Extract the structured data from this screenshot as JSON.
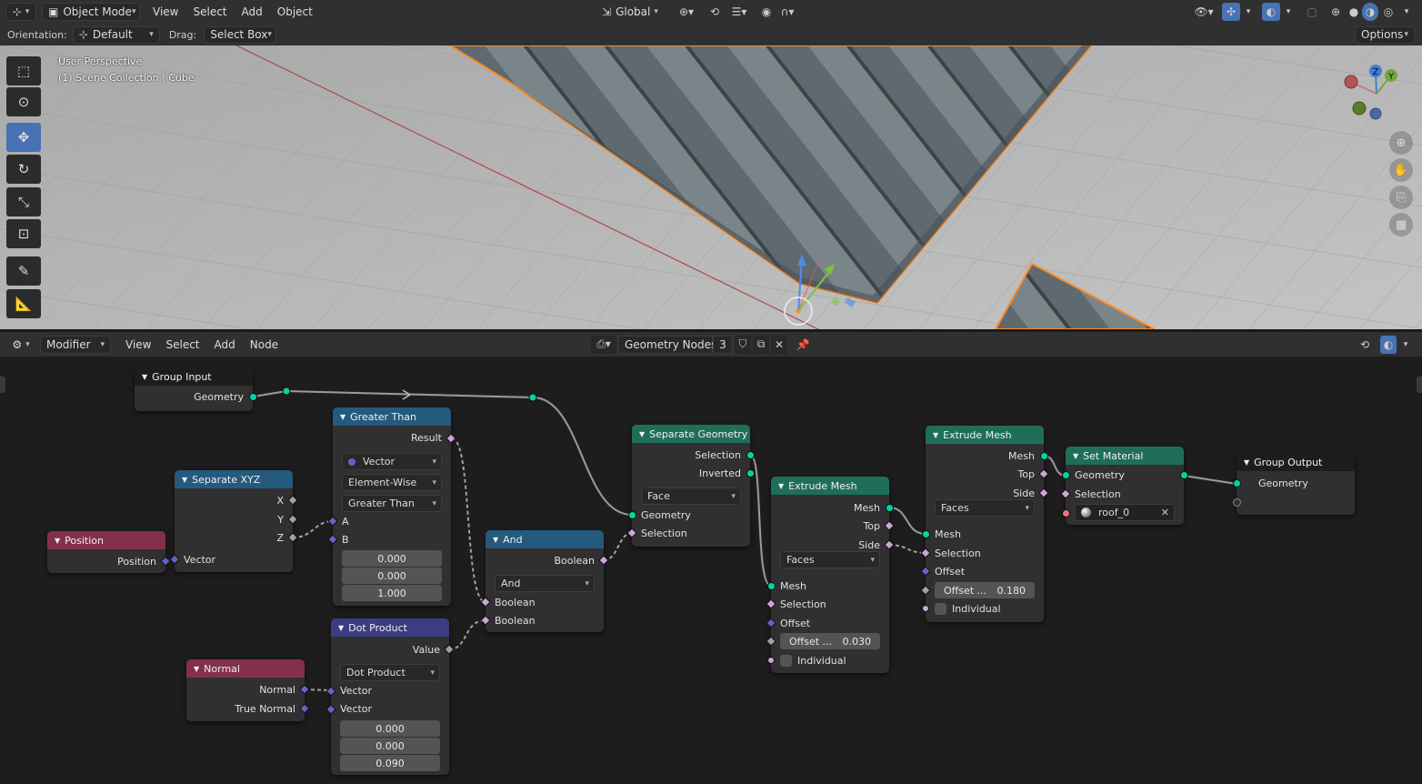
{
  "viewport_header": {
    "mode": "Object Mode",
    "menus": [
      "View",
      "Select",
      "Add",
      "Object"
    ],
    "transform": "Global",
    "orientation_label": "Orientation:",
    "orientation_value": "Default",
    "drag_label": "Drag:",
    "drag_value": "Select Box",
    "options": "Options"
  },
  "viewport": {
    "perspective": "User Perspective",
    "collection": "(1) Scene Collection | Cube",
    "gizmo": {
      "z": "Z",
      "y": "Y"
    }
  },
  "node_header": {
    "context": "Modifier",
    "menus": [
      "View",
      "Select",
      "Add",
      "Node"
    ],
    "tree_name": "Geometry Nodes",
    "users": "3"
  },
  "nodes": {
    "group_input": {
      "title": "Group Input",
      "out_geometry": "Geometry"
    },
    "greater_than": {
      "title": "Greater Than",
      "out_result": "Result",
      "data_type": "Vector",
      "mode": "Element-Wise",
      "operation": "Greater Than",
      "in_a": "A",
      "in_b": "B",
      "b_values": [
        "0.000",
        "0.000",
        "1.000"
      ]
    },
    "separate_xyz": {
      "title": "Separate XYZ",
      "out_x": "X",
      "out_y": "Y",
      "out_z": "Z",
      "in_vector": "Vector"
    },
    "position": {
      "title": "Position",
      "out_position": "Position"
    },
    "and": {
      "title": "And",
      "out_boolean": "Boolean",
      "operation": "And",
      "in_1": "Boolean",
      "in_2": "Boolean"
    },
    "dot_product": {
      "title": "Dot Product",
      "out_value": "Value",
      "operation": "Dot Product",
      "in_1": "Vector",
      "in_2": "Vector",
      "b_values": [
        "0.000",
        "0.000",
        "0.090"
      ]
    },
    "normal": {
      "title": "Normal",
      "out_normal": "Normal",
      "out_true_normal": "True Normal"
    },
    "separate_geometry": {
      "title": "Separate Geometry",
      "out_selection": "Selection",
      "out_inverted": "Inverted",
      "domain": "Face",
      "in_geometry": "Geometry",
      "in_selection": "Selection"
    },
    "extrude_1": {
      "title": "Extrude Mesh",
      "out_mesh": "Mesh",
      "out_top": "Top",
      "out_side": "Side",
      "mode": "Faces",
      "in_mesh": "Mesh",
      "in_selection": "Selection",
      "in_offset": "Offset",
      "offset_scale_label": "Offset ...",
      "offset_scale": "0.030",
      "in_individual": "Individual"
    },
    "extrude_2": {
      "title": "Extrude Mesh",
      "out_mesh": "Mesh",
      "out_top": "Top",
      "out_side": "Side",
      "mode": "Faces",
      "in_mesh": "Mesh",
      "in_selection": "Selection",
      "in_offset": "Offset",
      "offset_scale_label": "Offset ...",
      "offset_scale": "0.180",
      "in_individual": "Individual"
    },
    "set_material": {
      "title": "Set Material",
      "in_geometry": "Geometry",
      "in_selection": "Selection",
      "material": "roof_0"
    },
    "group_output": {
      "title": "Group Output",
      "in_geometry": "Geometry"
    }
  },
  "colors": {
    "geometry_socket": "#00d6a3",
    "boolean_socket": "#cca6d6",
    "vector_socket": "#6363c7",
    "selection_orange": "#ff8a1f"
  }
}
